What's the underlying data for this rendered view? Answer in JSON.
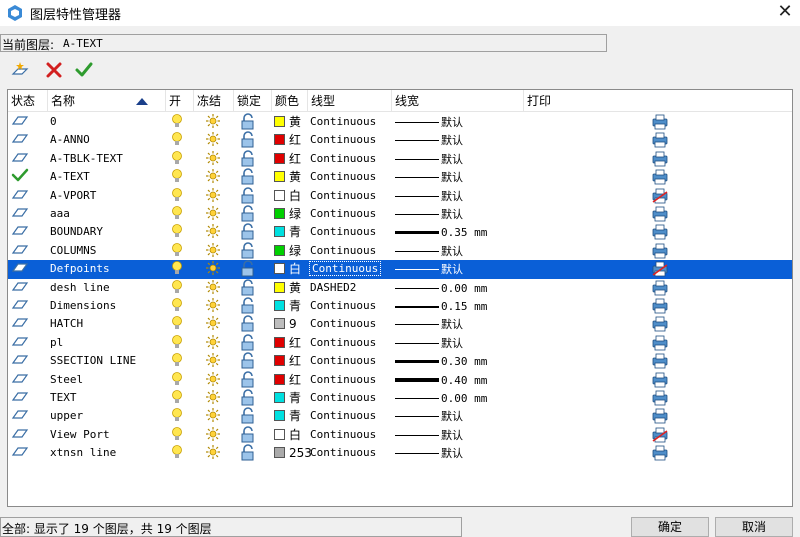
{
  "window": {
    "title": "图层特性管理器",
    "close_glyph": "✕"
  },
  "current_layer": {
    "label": "当前图层:",
    "value": "A-TEXT"
  },
  "toolbar": {
    "new_layer": "new-layer-icon",
    "delete_layer": "delete-layer-icon",
    "set_current": "set-current-icon"
  },
  "columns": {
    "status": "状态",
    "name": "名称",
    "on": "开",
    "freeze": "冻结",
    "lock": "锁定",
    "color": "颜色",
    "linetype": "线型",
    "lineweight": "线宽",
    "plot": "打印"
  },
  "layers": [
    {
      "name": "0",
      "status": "layer",
      "color": "黄",
      "color_hex": "#ffff00",
      "linetype": "Continuous",
      "lw": "默认",
      "lw_thick": 1,
      "plot": true
    },
    {
      "name": "A-ANNO",
      "status": "layer",
      "color": "红",
      "color_hex": "#e00000",
      "linetype": "Continuous",
      "lw": "默认",
      "lw_thick": 1,
      "plot": true
    },
    {
      "name": "A-TBLK-TEXT",
      "status": "layer",
      "color": "红",
      "color_hex": "#e00000",
      "linetype": "Continuous",
      "lw": "默认",
      "lw_thick": 1,
      "plot": true
    },
    {
      "name": "A-TEXT",
      "status": "current",
      "color": "黄",
      "color_hex": "#ffff00",
      "linetype": "Continuous",
      "lw": "默认",
      "lw_thick": 1,
      "plot": true
    },
    {
      "name": "A-VPORT",
      "status": "layer",
      "color": "白",
      "color_hex": "#ffffff",
      "linetype": "Continuous",
      "lw": "默认",
      "lw_thick": 1,
      "plot": false
    },
    {
      "name": "aaa",
      "status": "layer",
      "color": "绿",
      "color_hex": "#00d000",
      "linetype": "Continuous",
      "lw": "默认",
      "lw_thick": 1,
      "plot": true
    },
    {
      "name": "BOUNDARY",
      "status": "layer",
      "color": "青",
      "color_hex": "#00e0e0",
      "linetype": "Continuous",
      "lw": "0.35 mm",
      "lw_thick": 3,
      "plot": true
    },
    {
      "name": "COLUMNS",
      "status": "layer",
      "color": "绿",
      "color_hex": "#00d000",
      "linetype": "Continuous",
      "lw": "默认",
      "lw_thick": 1,
      "plot": true
    },
    {
      "name": "Defpoints",
      "status": "layer",
      "color": "白",
      "color_hex": "#ffffff",
      "linetype": "Continuous",
      "lw": "默认",
      "lw_thick": 1,
      "plot": false,
      "selected": true
    },
    {
      "name": "desh line",
      "status": "layer",
      "color": "黄",
      "color_hex": "#ffff00",
      "linetype": "DASHED2",
      "lw": "0.00 mm",
      "lw_thick": 1,
      "plot": true
    },
    {
      "name": "Dimensions",
      "status": "layer",
      "color": "青",
      "color_hex": "#00e0e0",
      "linetype": "Continuous",
      "lw": "0.15 mm",
      "lw_thick": 2,
      "plot": true
    },
    {
      "name": "HATCH",
      "status": "layer",
      "color": "9",
      "color_hex": "#bdbdbd",
      "linetype": "Continuous",
      "lw": "默认",
      "lw_thick": 1,
      "plot": true
    },
    {
      "name": "pl",
      "status": "layer",
      "color": "红",
      "color_hex": "#e00000",
      "linetype": "Continuous",
      "lw": "默认",
      "lw_thick": 1,
      "plot": true
    },
    {
      "name": "SSECTION LINE",
      "status": "layer",
      "color": "红",
      "color_hex": "#e00000",
      "linetype": "Continuous",
      "lw": "0.30 mm",
      "lw_thick": 3,
      "plot": true
    },
    {
      "name": "Steel",
      "status": "layer",
      "color": "红",
      "color_hex": "#e00000",
      "linetype": "Continuous",
      "lw": "0.40 mm",
      "lw_thick": 4,
      "plot": true
    },
    {
      "name": "TEXT",
      "status": "layer",
      "color": "青",
      "color_hex": "#00e0e0",
      "linetype": "Continuous",
      "lw": "0.00 mm",
      "lw_thick": 1,
      "plot": true
    },
    {
      "name": "upper",
      "status": "layer",
      "color": "青",
      "color_hex": "#00e0e0",
      "linetype": "Continuous",
      "lw": "默认",
      "lw_thick": 1,
      "plot": true
    },
    {
      "name": "View Port",
      "status": "layer",
      "color": "白",
      "color_hex": "#ffffff",
      "linetype": "Continuous",
      "lw": "默认",
      "lw_thick": 1,
      "plot": false
    },
    {
      "name": "xtnsn line",
      "status": "layer",
      "color": "253",
      "color_hex": "#aaaaaa",
      "linetype": "Continuous",
      "lw": "默认",
      "lw_thick": 1,
      "plot": true
    }
  ],
  "status_bar": {
    "text": "全部: 显示了 19 个图层，共 19 个图层"
  },
  "buttons": {
    "ok": "确定",
    "cancel": "取消"
  }
}
